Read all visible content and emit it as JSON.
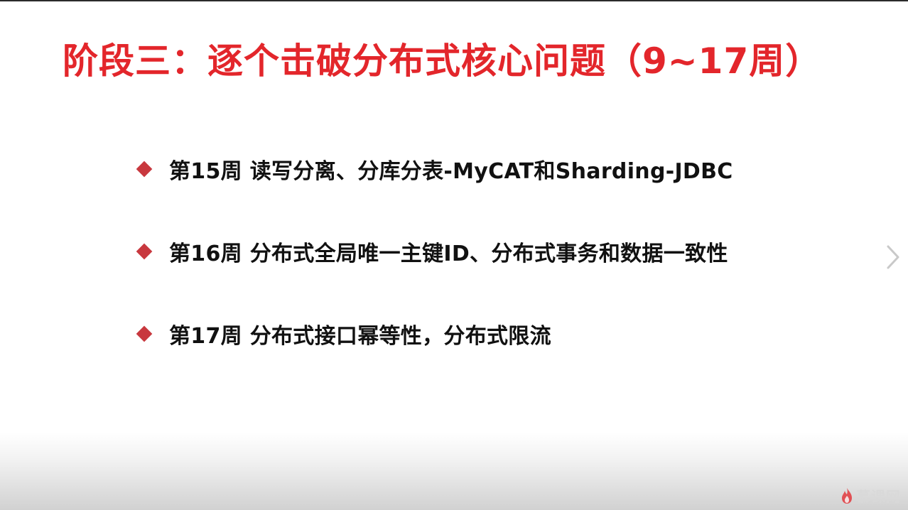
{
  "slide": {
    "title": "阶段三：逐个击破分布式核心问题（9~17周）",
    "bullets": [
      {
        "text": "第15周 读写分离、分库分表-MyCAT和Sharding-JDBC"
      },
      {
        "text": "第16周 分布式全局唯一主键ID、分布式事务和数据一致性"
      },
      {
        "text": "第17周 分布式接口幂等性，分布式限流"
      }
    ]
  },
  "navigation": {
    "next_icon": "chevron-right-icon"
  },
  "watermark": {
    "text": "慕课网",
    "icon": "flame-icon"
  },
  "colors": {
    "title": "#e3262b",
    "bullet_marker": "#c8383e",
    "text": "#111111",
    "background": "#ffffff"
  }
}
